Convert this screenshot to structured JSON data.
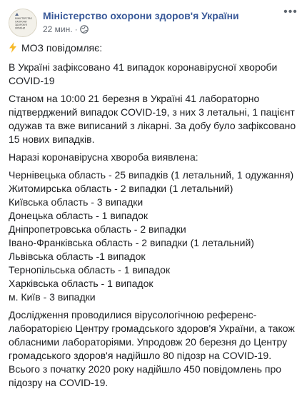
{
  "post": {
    "author": "Міністерство охорони здоров'я України",
    "time": "22 мин.",
    "avatar_text": [
      "МІНІСТЕРСТВО",
      "ОХОРОНИ",
      "ЗДОРОВ'Я",
      "УКРАЇНИ"
    ],
    "icons": {
      "more": "more-icon",
      "privacy": "globe-icon",
      "lead": "lightning-icon"
    },
    "colors": {
      "author": "#385898",
      "meta": "#616770",
      "bolt": "#f7b928"
    },
    "lead": "МОЗ повідомляє:",
    "intro": "В Україні зафіксовано 41 випадок коронавірусної хвороби COVID-19",
    "status": "Станом на 10:00 21 березня в Україні 41 лабораторно підтверджений випадок COVID-19, з них 3 летальні, 1 пацієнт одужав та вже виписаний з лікарні. За добу було зафіксовано 15 нових випадків.",
    "regions_intro": "Наразі коронавірусна хвороба виявлена:",
    "regions": [
      "Чернівецька область - 25 випадків (1 летальний, 1 одужання)",
      "Житомирська область - 2 випадки (1 летальний)",
      "Київська область - 3 випадки",
      "Донецька область - 1 випадок",
      "Дніпропетровська область - 2 випадки",
      "Івано-Франківська область - 2 випадки (1 летальний)",
      "Львівська область -1 випадок",
      "Тернопільська область - 1 випадок",
      "Харківська область - 1 випадок",
      "м. Київ - 3 випадки"
    ],
    "research": "Дослідження проводилися вірусологічною референс-лабораторією Центру громадського здоров'я України, а також обласними лабораторіями. Упродовж 20 березня до Центру громадського здоров'я надійшло 80 підозр на COVID-19. Всього з початку 2020 року надійшло 450 повідомлень про підозру на COVID-19."
  }
}
